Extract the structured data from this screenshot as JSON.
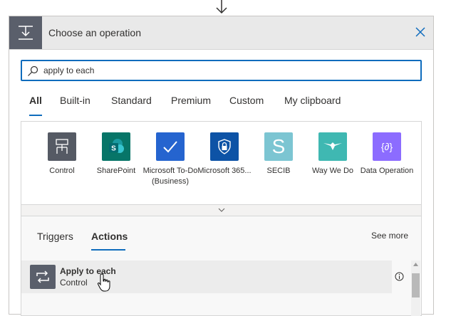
{
  "header": {
    "title": "Choose an operation"
  },
  "search": {
    "value": "apply to each"
  },
  "tabs": [
    {
      "label": "All",
      "active": true
    },
    {
      "label": "Built-in"
    },
    {
      "label": "Standard"
    },
    {
      "label": "Premium"
    },
    {
      "label": "Custom"
    },
    {
      "label": "My clipboard"
    }
  ],
  "connectors": [
    {
      "label": "Control",
      "color": "#555a64",
      "icon": "control-icon"
    },
    {
      "label": "SharePoint",
      "color": "#077568",
      "icon": "sharepoint-icon"
    },
    {
      "label": "Microsoft To-Do (Business)",
      "color": "#2564cf",
      "icon": "todo-icon"
    },
    {
      "label": "Microsoft 365...",
      "color": "#0d53a6",
      "icon": "shield-lock-icon"
    },
    {
      "label": "SECIB",
      "color": "#7cc5d2",
      "icon": "secib-icon"
    },
    {
      "label": "Way We Do",
      "color": "#3fb8b2",
      "icon": "waywedo-icon"
    },
    {
      "label": "Data Operation",
      "color": "#8c6cff",
      "icon": "data-operation-icon"
    }
  ],
  "actions_panel": {
    "tabs": [
      {
        "label": "Triggers"
      },
      {
        "label": "Actions",
        "active": true
      }
    ],
    "see_more": "See more",
    "items": [
      {
        "title": "Apply to each",
        "subtitle": "Control",
        "icon": "loop-icon"
      }
    ]
  }
}
